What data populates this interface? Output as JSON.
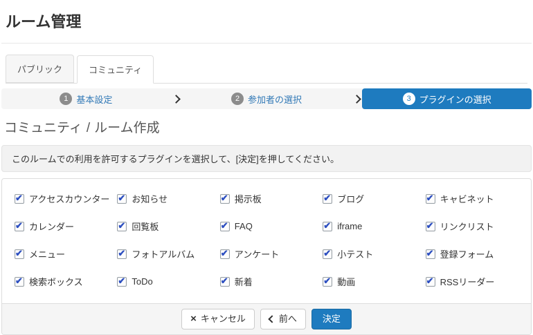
{
  "page": {
    "title": "ルーム管理"
  },
  "tabs": [
    {
      "label": "パブリック",
      "active": false
    },
    {
      "label": "コミュニティ",
      "active": true
    }
  ],
  "wizard": {
    "steps": [
      {
        "number": "1",
        "label": "基本設定",
        "active": false
      },
      {
        "number": "2",
        "label": "参加者の選択",
        "active": false
      },
      {
        "number": "3",
        "label": "プラグインの選択",
        "active": true
      }
    ]
  },
  "heading": {
    "prefix": "コミュニティ",
    "separator": "/",
    "suffix": "ルーム作成"
  },
  "alert": {
    "text": "このルームでの利用を許可するプラグインを選択して、[決定]を押してください。"
  },
  "plugins": {
    "all_checked": true,
    "items": [
      "アクセスカウンター",
      "お知らせ",
      "掲示板",
      "ブログ",
      "キャビネット",
      "カレンダー",
      "回覧板",
      "FAQ",
      "iframe",
      "リンクリスト",
      "メニュー",
      "フォトアルバム",
      "アンケート",
      "小テスト",
      "登録フォーム",
      "検索ボックス",
      "ToDo",
      "新着",
      "動画",
      "RSSリーダー"
    ]
  },
  "footer": {
    "cancel_label": "キャンセル",
    "cancel_icon_glyph": "×",
    "prev_label": "前へ",
    "submit_label": "決定"
  },
  "colors": {
    "primary": "#1e7bbf",
    "step_link": "#337ab7",
    "badge_gray": "#8c8c8c",
    "panel_border": "#dddddd",
    "footer_bg": "#f5f5f5"
  }
}
